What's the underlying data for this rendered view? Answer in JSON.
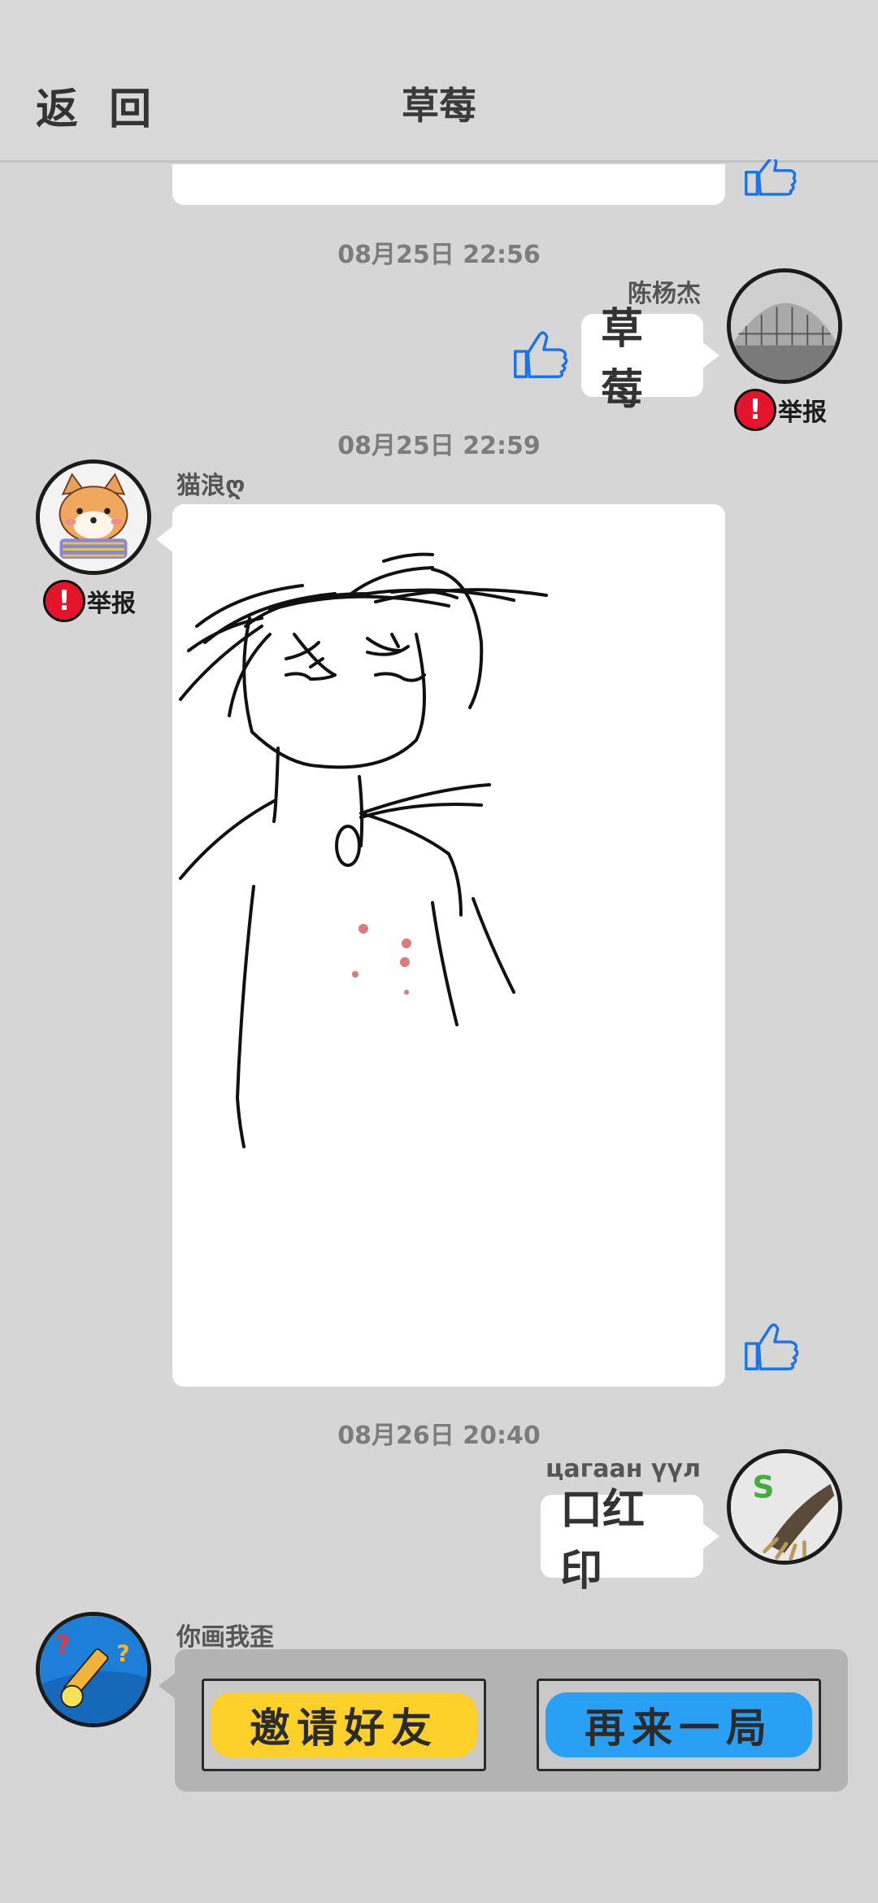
{
  "header": {
    "back_label": "返 回",
    "title": "草莓"
  },
  "messages": [
    {
      "timestamp": "08月25日  22:56",
      "sender": "陈杨杰",
      "text": "草莓",
      "report_label": "举报"
    },
    {
      "timestamp": "08月25日  22:59",
      "sender": "猫浪ღ",
      "type": "drawing",
      "report_label": "举报"
    },
    {
      "timestamp": "08月26日  20:40",
      "sender": "цагаан үүл",
      "text": "口红印"
    },
    {
      "sender": "你画我歪",
      "actions": {
        "invite_label": "邀请好友",
        "replay_label": "再来一局"
      }
    }
  ],
  "colors": {
    "background": "#d6d6d6",
    "like_blue": "#1a73e8",
    "report_red": "#e4142c",
    "invite_yellow": "#fdd02a",
    "replay_blue": "#2aa0f5"
  }
}
